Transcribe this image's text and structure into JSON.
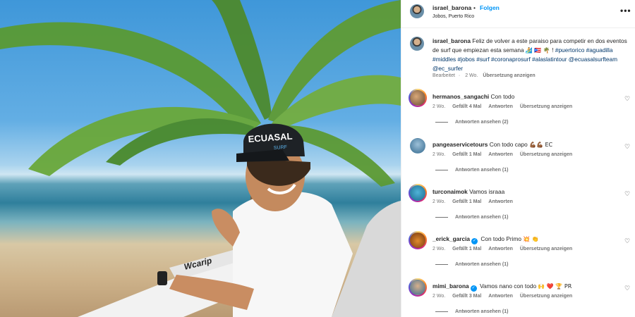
{
  "photo": {
    "hat_text": "ECUASAL",
    "hat_sub": "SURF",
    "board_text": "Wcarip"
  },
  "header": {
    "username": "israel_barona",
    "separator": "•",
    "follow_label": "Folgen",
    "location": "Jobos, Puerto Rico",
    "more_icon": "more-horizontal-icon",
    "more_label": "•••"
  },
  "caption": {
    "username": "israel_barona",
    "text": "Feliz de volver a este paraiso para competir en dos eventos de surf que empiezan esta semana",
    "emojis": "🏄 🇵🇷 🌴",
    "separator": "!",
    "hashtags": "#puertorico #aguadilla #middles #jobos #surf #coronaprosurf #alaslatintour @ecuasalsurfteam @ec_surfer",
    "edited": "Bearbeitet",
    "dot": "·",
    "age": "2 Wo.",
    "translate": "Übersetzung anzeigen"
  },
  "comments": [
    {
      "username": "hermanos_sangachi",
      "verified": false,
      "text": "Con todo",
      "emoji": "",
      "age": "2 Wo.",
      "likes": "Gefällt 4 Mal",
      "reply": "Antworten",
      "translate": "Übersetzung anzeigen",
      "replies": "Antworten ansehen (2)"
    },
    {
      "username": "pangeaservicetours",
      "verified": false,
      "text": "Con todo capo",
      "emoji": "💪🏾💪🏾 EC",
      "age": "2 Wo.",
      "likes": "Gefällt 1 Mal",
      "reply": "Antworten",
      "translate": "Übersetzung anzeigen",
      "replies": "Antworten ansehen (1)"
    },
    {
      "username": "turconaimok",
      "verified": false,
      "text": "Vamos israaa",
      "emoji": "",
      "age": "2 Wo.",
      "likes": "Gefällt 1 Mal",
      "reply": "Antworten",
      "translate": "",
      "replies": "Antworten ansehen (1)"
    },
    {
      "username": "_erick_garcia",
      "verified": true,
      "text": "Con todo Primo",
      "emoji": "💥 👏",
      "age": "2 Wo.",
      "likes": "Gefällt 1 Mal",
      "reply": "Antworten",
      "translate": "Übersetzung anzeigen",
      "replies": "Antworten ansehen (1)"
    },
    {
      "username": "mimi_barona",
      "verified": true,
      "text": "Vamos nano con todo",
      "emoji": "🙌 ❤️ 🏆 PR",
      "age": "2 Wo.",
      "likes": "Gefällt 3 Mal",
      "reply": "Antworten",
      "translate": "Übersetzung anzeigen",
      "replies": "Antworten ansehen (1)"
    }
  ],
  "icons": {
    "heart": "♡",
    "verified": "✓"
  }
}
